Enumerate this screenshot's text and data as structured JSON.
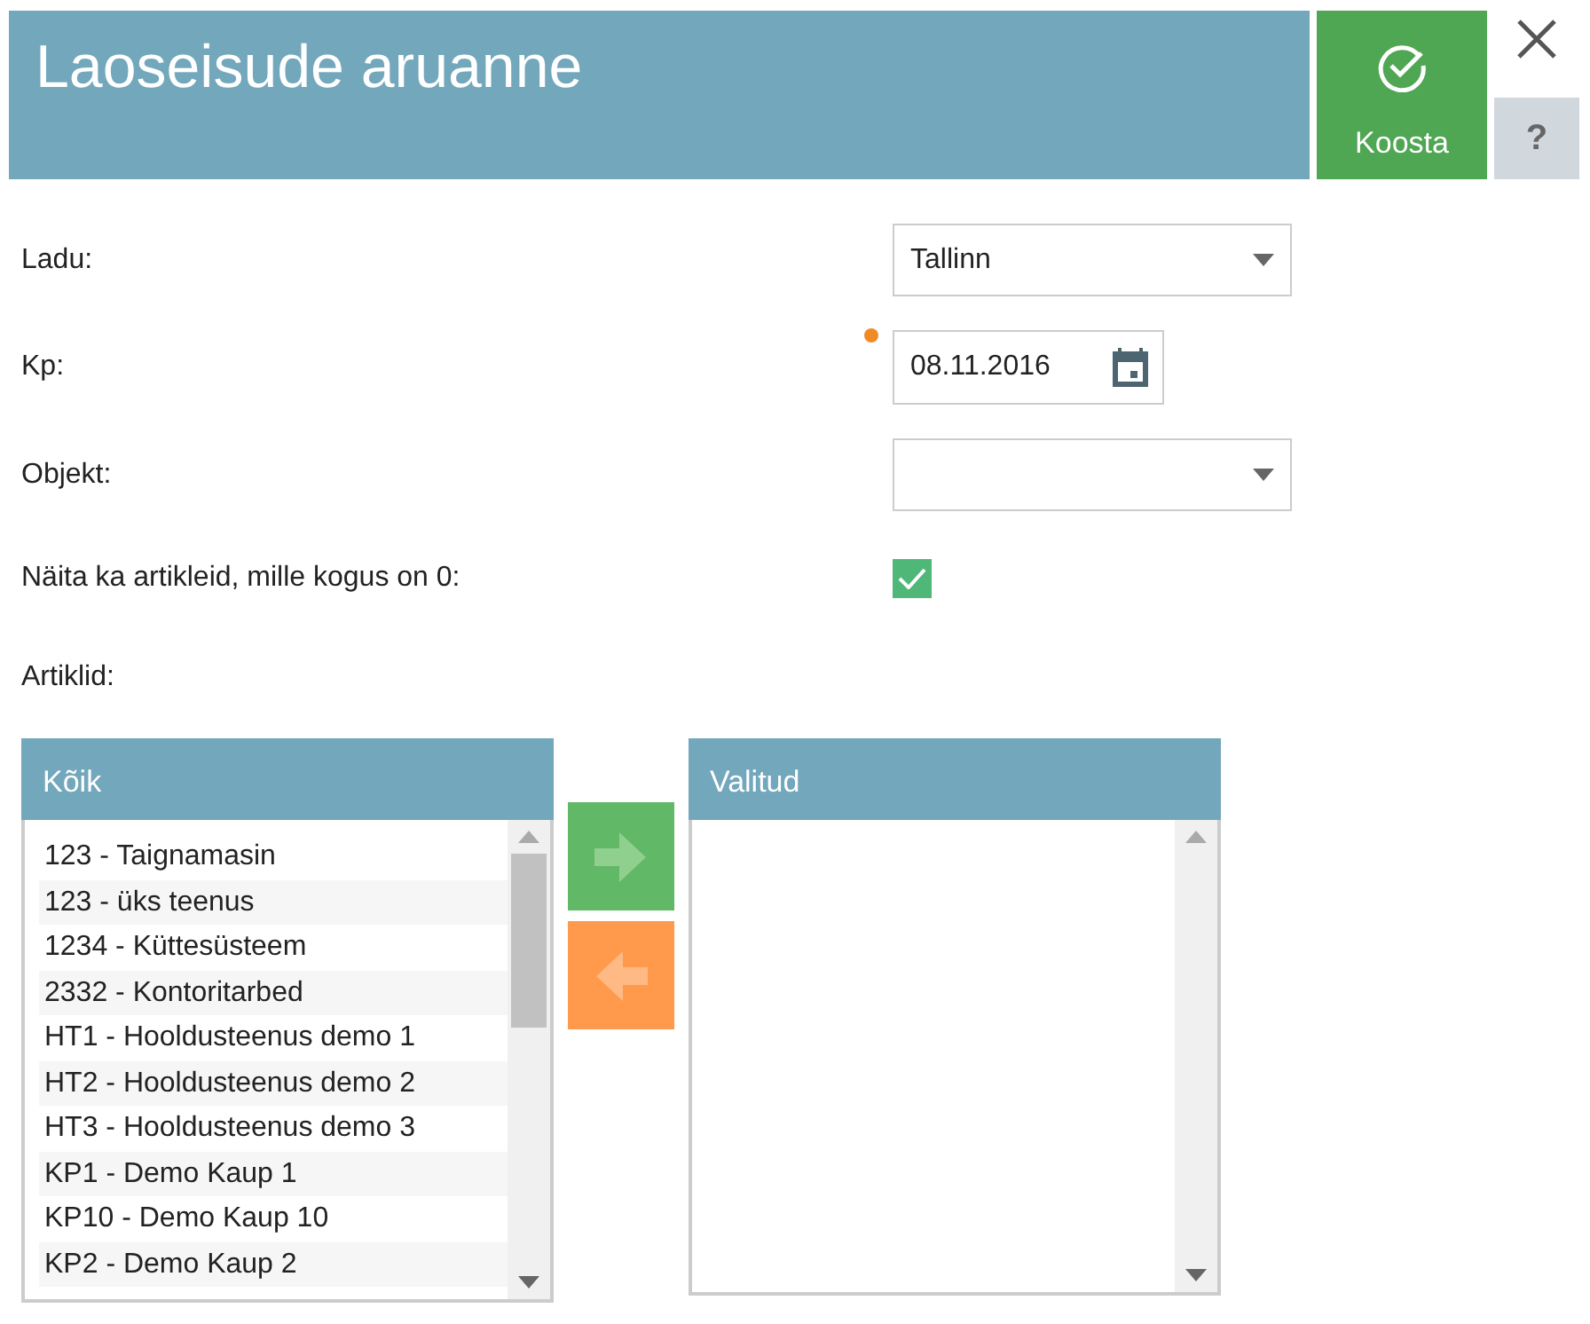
{
  "header": {
    "title": "Laoseisude aruanne",
    "submit_label": "Koosta",
    "help_label": "?"
  },
  "fields": [
    {
      "kind": "select",
      "label": "Ladu:",
      "value": "Tallinn"
    },
    {
      "kind": "date",
      "label": "Kp:",
      "value": "08.11.2016",
      "required": true
    },
    {
      "kind": "select",
      "label": "Objekt:"
    },
    {
      "kind": "checkbox",
      "label": "Näita ka artikleid, mille kogus on 0:",
      "checked": true
    }
  ],
  "articles_label": "Artiklid:",
  "available": {
    "title": "Kõik",
    "items": [
      {
        "text": "123 - Taignamasin"
      },
      {
        "text": "123 - üks teenus"
      },
      {
        "text": "1234 - Küttesüsteem"
      },
      {
        "text": "2332 - Kontoritarbed"
      },
      {
        "text": "HT1 - Hooldusteenus demo 1"
      },
      {
        "text": "HT2 - Hooldusteenus demo 2"
      },
      {
        "text": "HT3 - Hooldusteenus demo 3"
      },
      {
        "text": "KP1 - Demo Kaup 1"
      },
      {
        "text": "KP10 - Demo Kaup 10"
      },
      {
        "text": "KP2 - Demo Kaup 2"
      }
    ]
  },
  "selected_list": {
    "title": "Valitud"
  }
}
